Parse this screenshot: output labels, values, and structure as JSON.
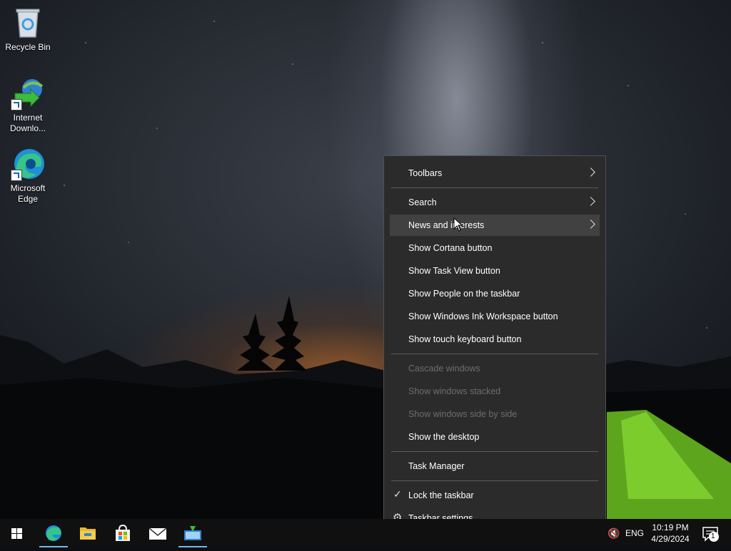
{
  "desktop": {
    "icons": [
      {
        "label": "Recycle Bin"
      },
      {
        "label": "Internet Downlo..."
      },
      {
        "label": "Microsoft Edge"
      }
    ]
  },
  "context_menu": {
    "items": [
      {
        "label": "Toolbars",
        "submenu": true
      },
      {
        "label": "Search",
        "submenu": true
      },
      {
        "label": "News and interests",
        "submenu": true,
        "hovered": true
      },
      {
        "label": "Show Cortana button"
      },
      {
        "label": "Show Task View button"
      },
      {
        "label": "Show People on the taskbar"
      },
      {
        "label": "Show Windows Ink Workspace button"
      },
      {
        "label": "Show touch keyboard button"
      },
      {
        "label": "Cascade windows",
        "disabled": true
      },
      {
        "label": "Show windows stacked",
        "disabled": true
      },
      {
        "label": "Show windows side by side",
        "disabled": true
      },
      {
        "label": "Show the desktop"
      },
      {
        "label": "Task Manager"
      },
      {
        "label": "Lock the taskbar",
        "checked": true
      },
      {
        "label": "Taskbar settings"
      }
    ]
  },
  "taskbar": {
    "language": "ENG",
    "time": "10:19 PM",
    "date": "4/29/2024",
    "notification_count": "1",
    "accent_color": "#76b9ed"
  },
  "colors": {
    "menu_background": "#2b2b2b",
    "menu_hover": "#414141",
    "menu_disabled_text": "#6d6d6d",
    "taskbar": "#101010"
  }
}
